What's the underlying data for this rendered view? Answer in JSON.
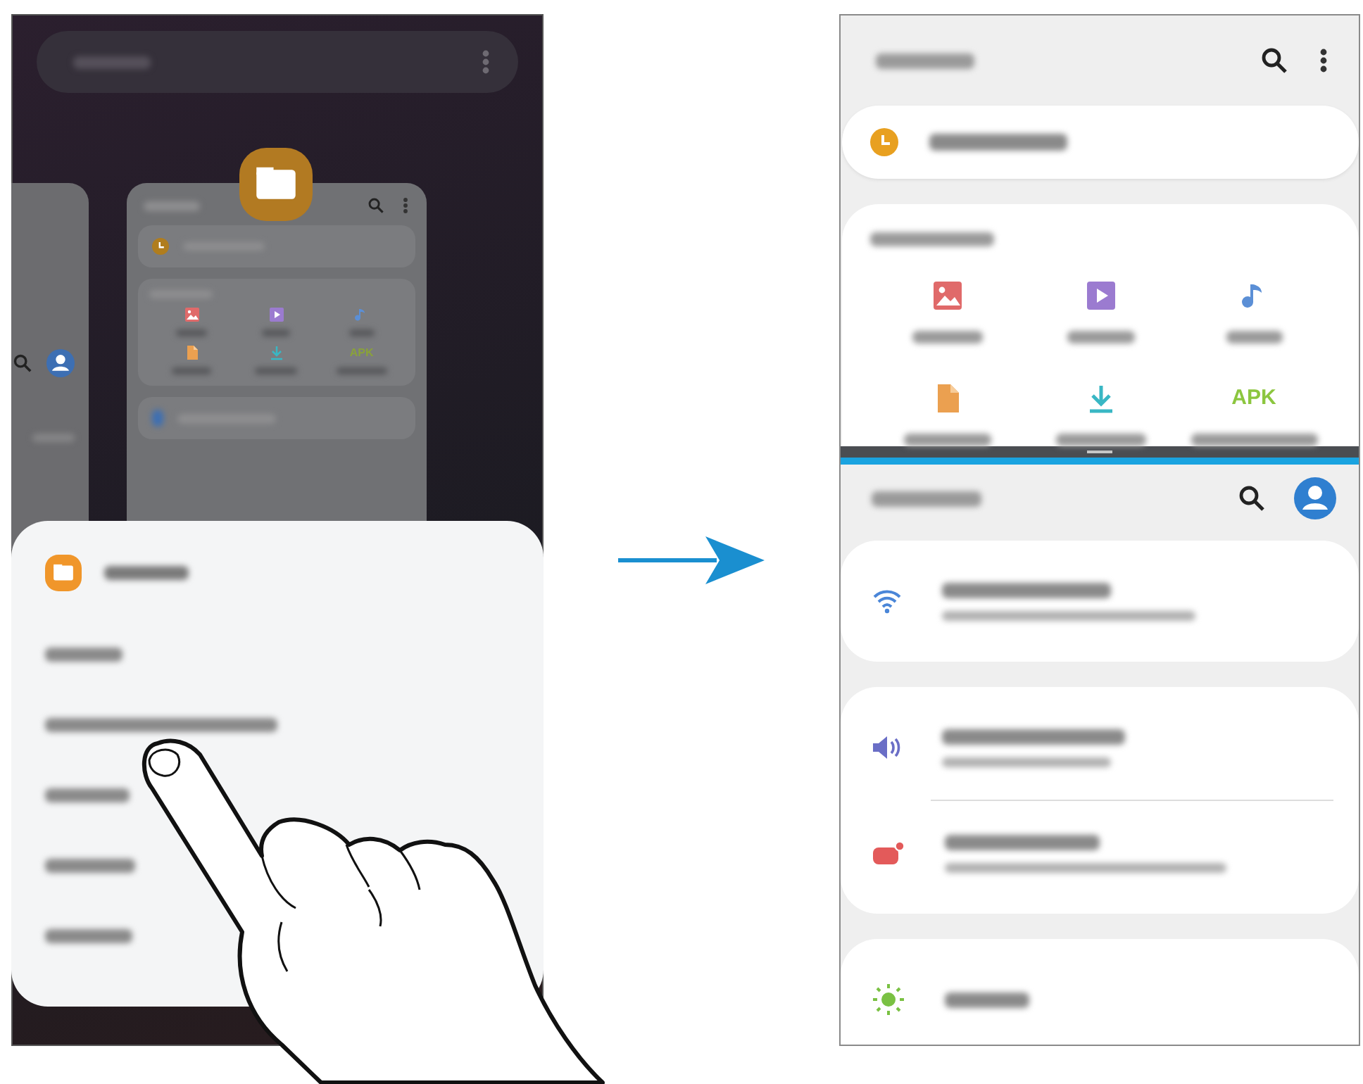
{
  "recents_screen": {
    "preview_card": {
      "categories": [
        {
          "kind": "image"
        },
        {
          "kind": "video"
        },
        {
          "kind": "audio"
        },
        {
          "kind": "document"
        },
        {
          "kind": "download"
        },
        {
          "kind": "apk",
          "text": "APK"
        }
      ]
    },
    "app_menu": {
      "options": [
        {
          "kind": "option"
        },
        {
          "kind": "option"
        },
        {
          "kind": "option"
        },
        {
          "kind": "option"
        },
        {
          "kind": "option"
        }
      ]
    }
  },
  "split_screen": {
    "top_app": {
      "categories": [
        {
          "kind": "image"
        },
        {
          "kind": "video"
        },
        {
          "kind": "audio"
        },
        {
          "kind": "document"
        },
        {
          "kind": "download"
        },
        {
          "kind": "apk",
          "text": "APK"
        }
      ]
    },
    "bottom_app": {
      "groups": [
        {
          "items": [
            {
              "kind": "wifi"
            }
          ]
        },
        {
          "items": [
            {
              "kind": "sound"
            },
            {
              "kind": "notifications"
            }
          ]
        },
        {
          "items": [
            {
              "kind": "display"
            }
          ]
        }
      ]
    }
  }
}
